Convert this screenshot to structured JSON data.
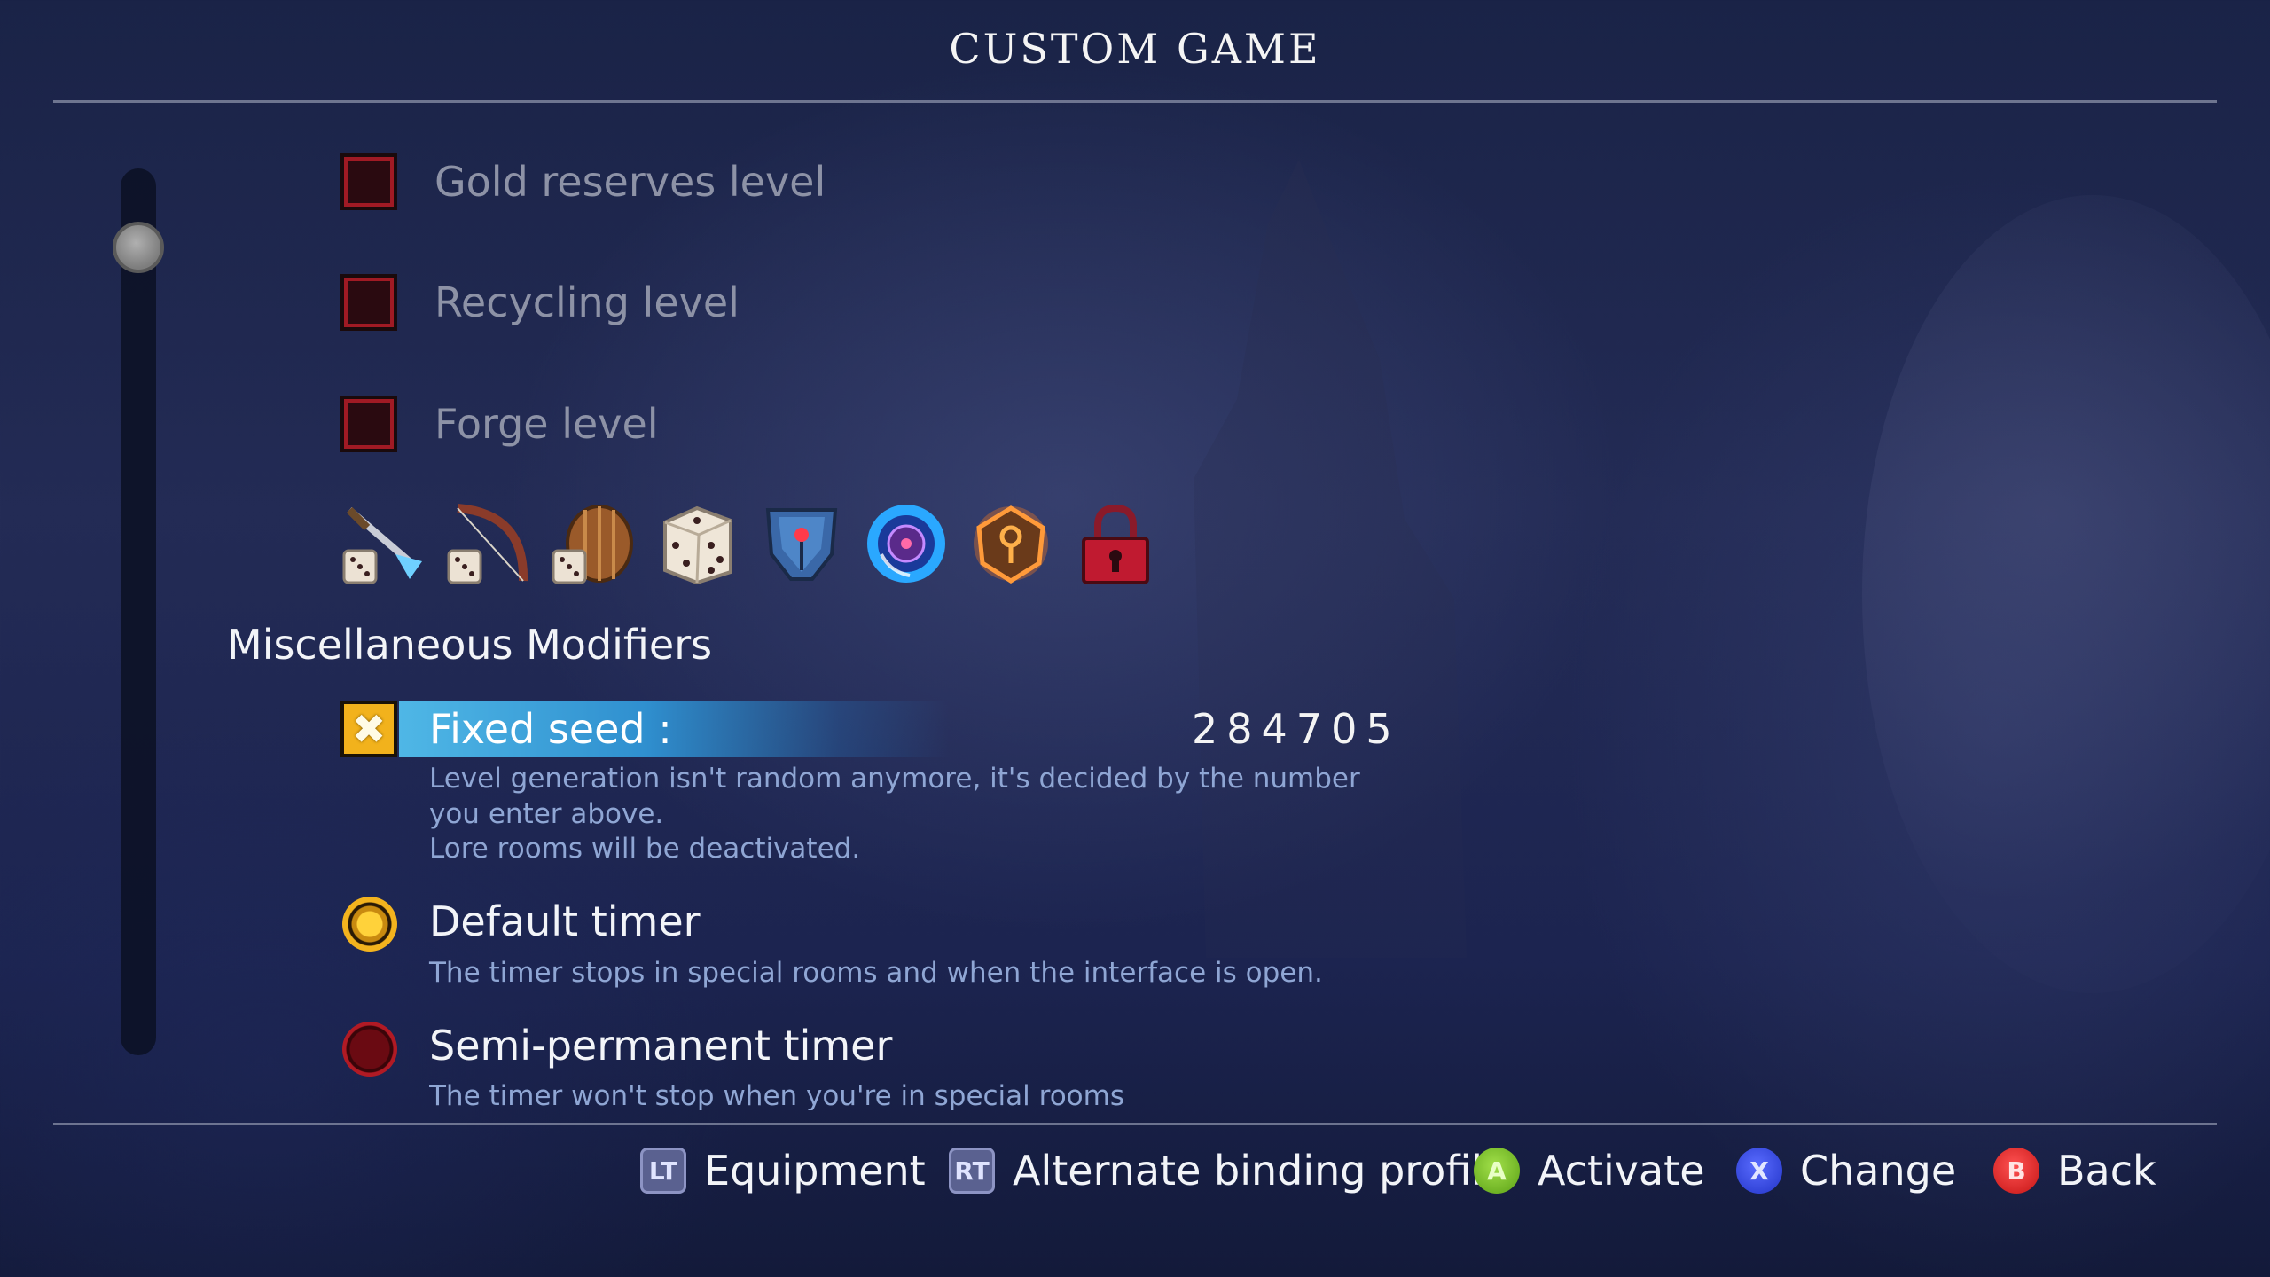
{
  "screen": {
    "title": "CUSTOM GAME"
  },
  "levels": [
    {
      "label": "Gold reserves level",
      "checked": false
    },
    {
      "label": "Recycling level",
      "checked": false
    },
    {
      "label": "Forge level",
      "checked": false
    }
  ],
  "icons": [
    "dice-sword-icon",
    "dice-bow-icon",
    "dice-shield-icon",
    "dice-icon",
    "blue-mask-icon",
    "blue-orb-icon",
    "orange-amulet-icon",
    "red-lock-icon"
  ],
  "misc": {
    "section_title": "Miscellaneous Modifiers",
    "fixed_seed": {
      "label": "Fixed seed :",
      "value": "284705",
      "checked": true,
      "desc_line1": "Level generation isn't random anymore, it's decided by the number",
      "desc_line2": "you enter above.",
      "desc_line3": "Lore rooms will be deactivated."
    },
    "default_timer": {
      "label": "Default timer",
      "desc": "The timer stops in special rooms and when the interface is open.",
      "selected": true
    },
    "semi_timer": {
      "label": "Semi-permanent timer",
      "desc": "The timer won't stop when you're in special rooms",
      "selected": false
    }
  },
  "footer": [
    {
      "button": "LT",
      "label": "Equipment"
    },
    {
      "button": "RT",
      "label": "Alternate binding profile"
    },
    {
      "button": "A",
      "label": "Activate"
    },
    {
      "button": "X",
      "label": "Change"
    },
    {
      "button": "B",
      "label": "Back"
    }
  ],
  "colors": {
    "highlight": "#3aa3dd",
    "accent_gold": "#f2b21c",
    "checkbox_red": "#a01a24"
  }
}
